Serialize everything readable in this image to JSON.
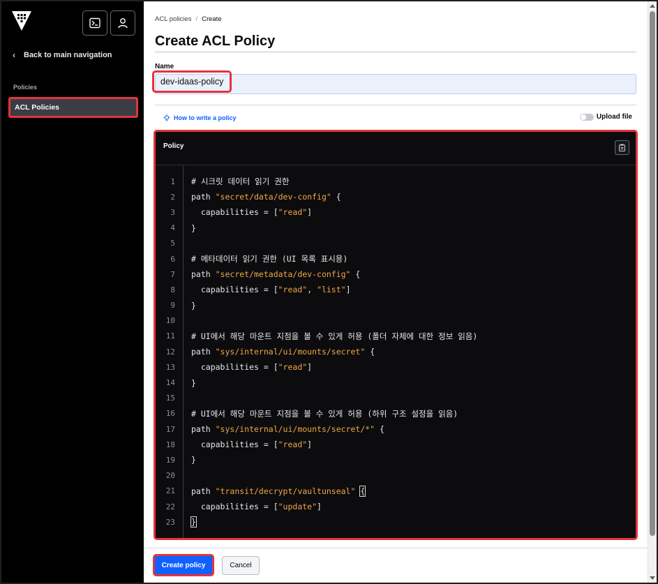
{
  "sidebar": {
    "back_label": "Back to main navigation",
    "section_label": "Policies",
    "items": [
      {
        "label": "ACL Policies",
        "active": true
      }
    ]
  },
  "breadcrumb": {
    "parent": "ACL policies",
    "separator": "/",
    "current": "Create"
  },
  "page": {
    "title": "Create ACL Policy"
  },
  "name_field": {
    "label": "Name",
    "value": "dev-idaas-policy"
  },
  "policy_toolbar": {
    "how_to_link": "How to write a policy",
    "upload_label": "Upload file",
    "upload_enabled": false
  },
  "editor": {
    "title": "Policy",
    "lines": [
      {
        "n": "1",
        "parts": [
          {
            "t": "# 시크릿 데이터 읽기 권한",
            "c": "cm"
          }
        ]
      },
      {
        "n": "2",
        "parts": [
          {
            "t": "path ",
            "c": ""
          },
          {
            "t": "\"secret/data/dev-config\"",
            "c": "str"
          },
          {
            "t": " {",
            "c": ""
          }
        ]
      },
      {
        "n": "3",
        "parts": [
          {
            "t": "  capabilities = [",
            "c": ""
          },
          {
            "t": "\"read\"",
            "c": "str"
          },
          {
            "t": "]",
            "c": ""
          }
        ]
      },
      {
        "n": "4",
        "parts": [
          {
            "t": "}",
            "c": ""
          }
        ]
      },
      {
        "n": "5",
        "parts": []
      },
      {
        "n": "6",
        "parts": [
          {
            "t": "# 메타데이터 읽기 권한 (UI 목록 표시용)",
            "c": "cm"
          }
        ]
      },
      {
        "n": "7",
        "parts": [
          {
            "t": "path ",
            "c": ""
          },
          {
            "t": "\"secret/metadata/dev-config\"",
            "c": "str"
          },
          {
            "t": " {",
            "c": ""
          }
        ]
      },
      {
        "n": "8",
        "parts": [
          {
            "t": "  capabilities = [",
            "c": ""
          },
          {
            "t": "\"read\"",
            "c": "str"
          },
          {
            "t": ", ",
            "c": ""
          },
          {
            "t": "\"list\"",
            "c": "str"
          },
          {
            "t": "]",
            "c": ""
          }
        ]
      },
      {
        "n": "9",
        "parts": [
          {
            "t": "}",
            "c": ""
          }
        ]
      },
      {
        "n": "10",
        "parts": []
      },
      {
        "n": "11",
        "parts": [
          {
            "t": "# UI에서 해당 마운트 지점을 볼 수 있게 허용 (폴더 자체에 대한 정보 읽음)",
            "c": "cm"
          }
        ]
      },
      {
        "n": "12",
        "parts": [
          {
            "t": "path ",
            "c": ""
          },
          {
            "t": "\"sys/internal/ui/mounts/secret\"",
            "c": "str"
          },
          {
            "t": " {",
            "c": ""
          }
        ]
      },
      {
        "n": "13",
        "parts": [
          {
            "t": "  capabilities = [",
            "c": ""
          },
          {
            "t": "\"read\"",
            "c": "str"
          },
          {
            "t": "]",
            "c": ""
          }
        ]
      },
      {
        "n": "14",
        "parts": [
          {
            "t": "}",
            "c": ""
          }
        ]
      },
      {
        "n": "15",
        "parts": []
      },
      {
        "n": "16",
        "parts": [
          {
            "t": "# UI에서 해당 마운트 지점을 볼 수 있게 허용 (하위 구조 설정을 읽음)",
            "c": "cm"
          }
        ]
      },
      {
        "n": "17",
        "parts": [
          {
            "t": "path ",
            "c": ""
          },
          {
            "t": "\"sys/internal/ui/mounts/secret/*\"",
            "c": "str"
          },
          {
            "t": " {",
            "c": ""
          }
        ]
      },
      {
        "n": "18",
        "parts": [
          {
            "t": "  capabilities = [",
            "c": ""
          },
          {
            "t": "\"read\"",
            "c": "str"
          },
          {
            "t": "]",
            "c": ""
          }
        ]
      },
      {
        "n": "19",
        "parts": [
          {
            "t": "}",
            "c": ""
          }
        ]
      },
      {
        "n": "20",
        "parts": []
      },
      {
        "n": "21",
        "parts": [
          {
            "t": "path ",
            "c": ""
          },
          {
            "t": "\"transit/decrypt/vaultunseal\"",
            "c": "str"
          },
          {
            "t": " ",
            "c": ""
          },
          {
            "t": "{",
            "c": "hl"
          }
        ]
      },
      {
        "n": "22",
        "parts": [
          {
            "t": "  capabilities = [",
            "c": ""
          },
          {
            "t": "\"update\"",
            "c": "str"
          },
          {
            "t": "]",
            "c": ""
          }
        ]
      },
      {
        "n": "23",
        "parts": [
          {
            "t": "}",
            "c": "hl"
          }
        ]
      }
    ]
  },
  "actions": {
    "create_label": "Create policy",
    "cancel_label": "Cancel"
  },
  "colors": {
    "sidebar_bg": "#000000",
    "editor_bg": "#0c0c0e",
    "string": "#f1a646",
    "primary": "#1060ff",
    "highlight_border": "#e3343d"
  }
}
